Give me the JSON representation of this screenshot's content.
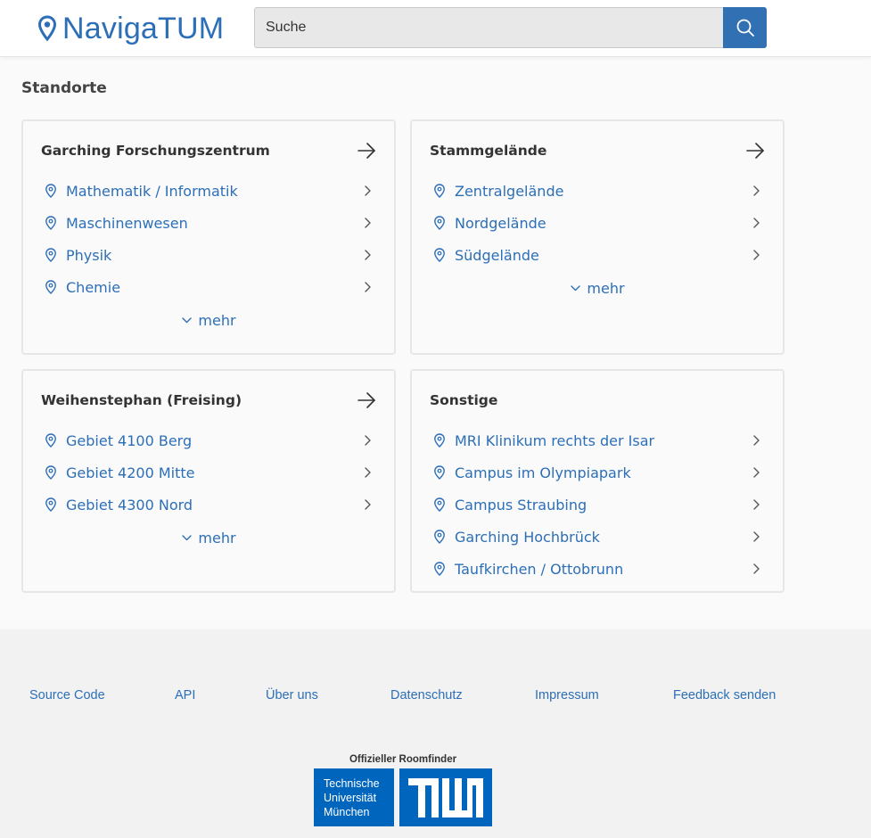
{
  "header": {
    "logo_text": "NavigaTUM",
    "search_placeholder": "Suche"
  },
  "section_title": "Standorte",
  "more_label": "mehr",
  "cards": [
    {
      "title": "Garching Forschungszentrum",
      "items": [
        "Mathematik / Informatik",
        "Maschinenwesen",
        "Physik",
        "Chemie"
      ],
      "has_more": true
    },
    {
      "title": "Stammgelände",
      "items": [
        "Zentralgelände",
        "Nordgelände",
        "Südgelände"
      ],
      "has_more": true
    },
    {
      "title": "Weihenstephan (Freising)",
      "items": [
        "Gebiet 4100 Berg",
        "Gebiet 4200 Mitte",
        "Gebiet 4300 Nord"
      ],
      "has_more": true
    },
    {
      "title": "Sonstige",
      "items": [
        "MRI Klinikum rechts der Isar",
        "Campus im Olympiapark",
        "Campus Straubing",
        "Garching Hochbrück",
        "Taufkirchen / Ottobrunn"
      ],
      "has_more": false
    }
  ],
  "footer": {
    "links": [
      "Source Code",
      "API",
      "Über uns",
      "Datenschutz",
      "Impressum",
      "Feedback senden"
    ],
    "official_label": "Offizieller Roomfinder",
    "university_name": "Technische Universität München"
  },
  "colors": {
    "accent": "#2c6fb7",
    "button": "#3070b3",
    "tum_blue": "#0065bd"
  },
  "icons": {
    "logo": "map-pin-icon",
    "search": "search-icon",
    "card_link": "arrow-right-icon",
    "item": "map-pin-icon",
    "item_chevron": "chevron-right-icon",
    "more": "chevron-down-icon"
  }
}
